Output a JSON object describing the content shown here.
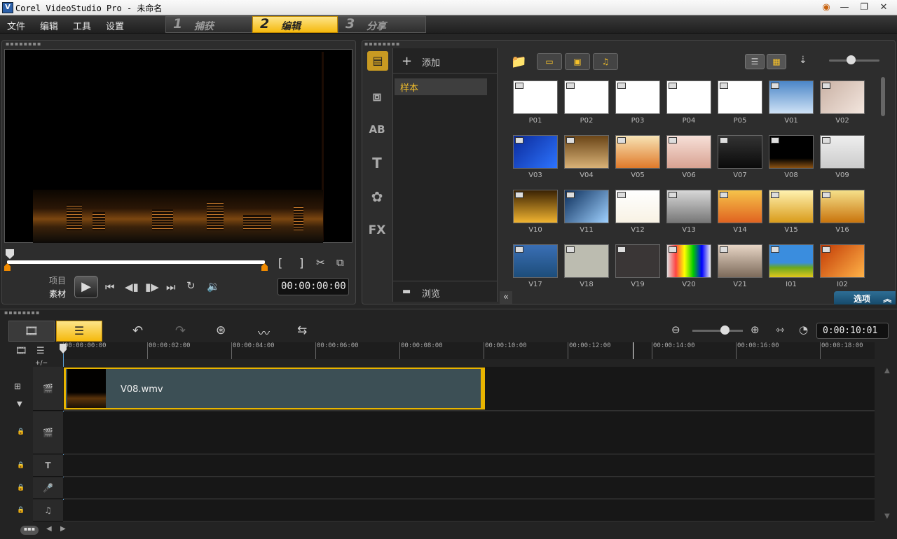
{
  "window": {
    "title": "Corel VideoStudio Pro - 未命名",
    "controls": [
      "◉",
      "—",
      "❐",
      "✕"
    ]
  },
  "menu": [
    "文件",
    "编辑",
    "工具",
    "设置"
  ],
  "steps": [
    {
      "num": "1",
      "label": "捕获"
    },
    {
      "num": "2",
      "label": "编辑"
    },
    {
      "num": "3",
      "label": "分享"
    }
  ],
  "player": {
    "mode_project": "项目",
    "mode_clip": "素材",
    "timecode": "00:00:00:00",
    "mark_in": "[",
    "mark_out": "]"
  },
  "library": {
    "add_label": "添加",
    "folder_selected": "样本",
    "browse_label": "浏览",
    "options_label": "选项",
    "side_tabs": [
      "AB",
      "T",
      "FX"
    ],
    "items": [
      "P01",
      "P02",
      "P03",
      "P04",
      "P05",
      "V01",
      "V02",
      "V03",
      "V04",
      "V05",
      "V06",
      "V07",
      "V08",
      "V09",
      "V10",
      "V11",
      "V12",
      "V13",
      "V14",
      "V15",
      "V16",
      "V17",
      "V18",
      "V19",
      "V20",
      "V21",
      "I01",
      "I02"
    ]
  },
  "timeline": {
    "timecode": "0:00:10:01",
    "ruler": [
      "00:00:00:00",
      "00:00:02:00",
      "00:00:04:00",
      "00:00:06:00",
      "00:00:08:00",
      "00:00:10:00",
      "00:00:12:00",
      "00:00:14:00",
      "00:00:16:00",
      "00:00:18:00"
    ],
    "clip_name": "V08.wmv",
    "add_remove": "+/−"
  }
}
